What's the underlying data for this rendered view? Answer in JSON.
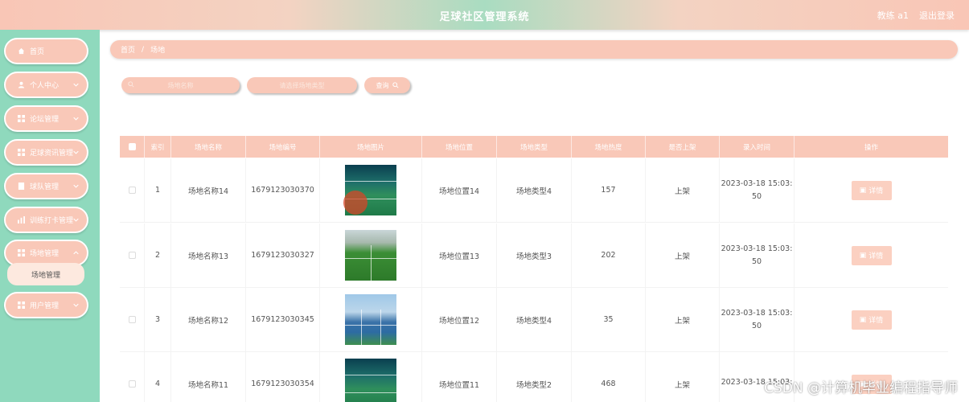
{
  "header": {
    "title": "足球社区管理系统",
    "user": "教练 a1",
    "logout": "退出登录"
  },
  "sidebar": {
    "items": [
      {
        "label": "首页",
        "icon": "home-icon"
      },
      {
        "label": "个人中心",
        "icon": "user-icon"
      },
      {
        "label": "论坛管理",
        "icon": "grid-icon"
      },
      {
        "label": "足球资讯管理",
        "icon": "grid-icon"
      },
      {
        "label": "球队管理",
        "icon": "doc-icon"
      },
      {
        "label": "训练打卡管理",
        "icon": "bar-chart-icon"
      },
      {
        "label": "场地管理",
        "icon": "grid-icon"
      },
      {
        "label": "用户管理",
        "icon": "grid-icon"
      }
    ],
    "submenu": "场地管理"
  },
  "breadcrumb": {
    "home": "首页",
    "sep": "/",
    "current": "场地"
  },
  "search": {
    "name_placeholder": "场地名称",
    "type_placeholder": "请选择场地类型",
    "button": "查询"
  },
  "table": {
    "headers": [
      "索引",
      "场地名称",
      "场地编号",
      "场地图片",
      "场地位置",
      "场地类型",
      "场地热度",
      "是否上架",
      "录入时间",
      "操作"
    ],
    "detail_label": "详情",
    "rows": [
      {
        "index": "1",
        "name": "场地名称14",
        "code": "1679123030370",
        "location": "场地位置14",
        "type": "场地类型4",
        "heat": "157",
        "status": "上架",
        "time1": "2023-03-18 15:03:",
        "time2": "50",
        "image": "indoor-field"
      },
      {
        "index": "2",
        "name": "场地名称13",
        "code": "1679123030327",
        "location": "场地位置13",
        "type": "场地类型3",
        "heat": "202",
        "status": "上架",
        "time1": "2023-03-18 15:03:",
        "time2": "50",
        "image": "turf-field"
      },
      {
        "index": "3",
        "name": "场地名称12",
        "code": "1679123030345",
        "location": "场地位置12",
        "type": "场地类型4",
        "heat": "35",
        "status": "上架",
        "time1": "2023-03-18 15:03:",
        "time2": "50",
        "image": "blue-court"
      },
      {
        "index": "4",
        "name": "场地名称11",
        "code": "1679123030354",
        "location": "场地位置11",
        "type": "场地类型2",
        "heat": "468",
        "status": "上架",
        "time1": "2023-03-18 15:03:",
        "time2": "",
        "image": "indoor-field"
      }
    ]
  },
  "watermark": "CSDN @计算机毕业编程指导师"
}
